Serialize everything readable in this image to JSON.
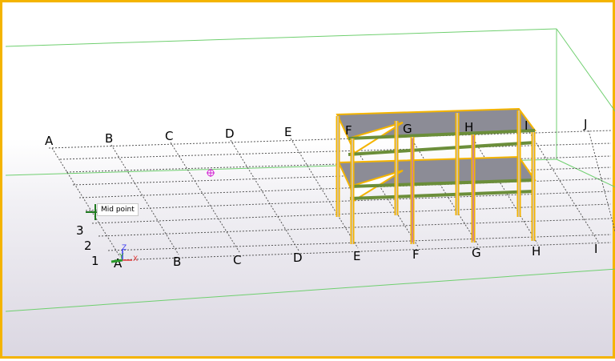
{
  "viewport": {
    "border_color": "#f4b400",
    "selection_color": "#f4b400",
    "grid_line_color": "#555555",
    "workarea_color": "#55cc55"
  },
  "grid": {
    "top_labels": [
      "A",
      "B",
      "C",
      "D",
      "E",
      "F",
      "G",
      "H",
      "I",
      "J"
    ],
    "bottom_labels": [
      "A",
      "B",
      "C",
      "D",
      "E",
      "F",
      "G",
      "H",
      "I"
    ],
    "row_labels": [
      "3",
      "2",
      "1"
    ]
  },
  "snap_tooltip": {
    "text": "Mid point"
  },
  "axis_indicator": {
    "z": "Z",
    "y": "Y",
    "x": "X"
  },
  "icons": {
    "snap_marker": "crosshair-circle-icon",
    "cursor": "snap-cross-icon"
  }
}
